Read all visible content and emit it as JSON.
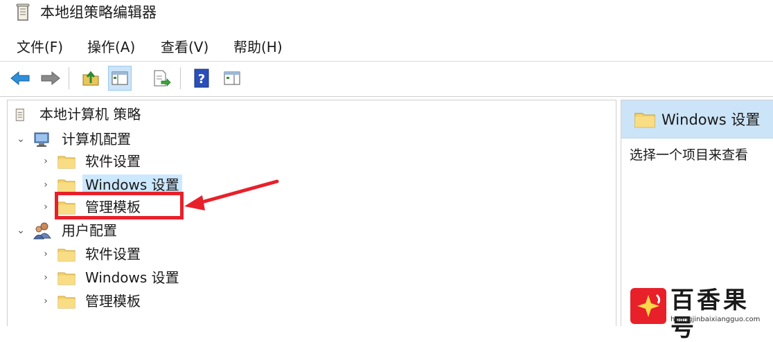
{
  "window": {
    "title": "本地组策略编辑器"
  },
  "menu": [
    {
      "label": "文件(F)"
    },
    {
      "label": "操作(A)"
    },
    {
      "label": "查看(V)"
    },
    {
      "label": "帮助(H)"
    }
  ],
  "toolbar": {
    "icons": [
      "back-arrow-icon",
      "forward-arrow-icon",
      "up-folder-icon",
      "show-hide-tree-icon",
      "export-list-icon",
      "help-icon",
      "properties-pane-icon"
    ]
  },
  "tree": {
    "root": "本地计算机 策略",
    "computer_config": "计算机配置",
    "computer_children": [
      "软件设置",
      "Windows 设置",
      "管理模板"
    ],
    "user_config": "用户配置",
    "user_children": [
      "软件设置",
      "Windows 设置",
      "管理模板"
    ],
    "selected": "Windows 设置"
  },
  "right_pane": {
    "header": "Windows 设置",
    "description": "选择一个项目来查看"
  },
  "colors": {
    "selection": "#cce8ff",
    "header_bg": "#cce4f7",
    "annotation_red": "#e8202a",
    "folder_yellow": "#f5d26b"
  },
  "watermark": {
    "name": "百香果号",
    "url": "huangjinbaixiangguo.com"
  }
}
